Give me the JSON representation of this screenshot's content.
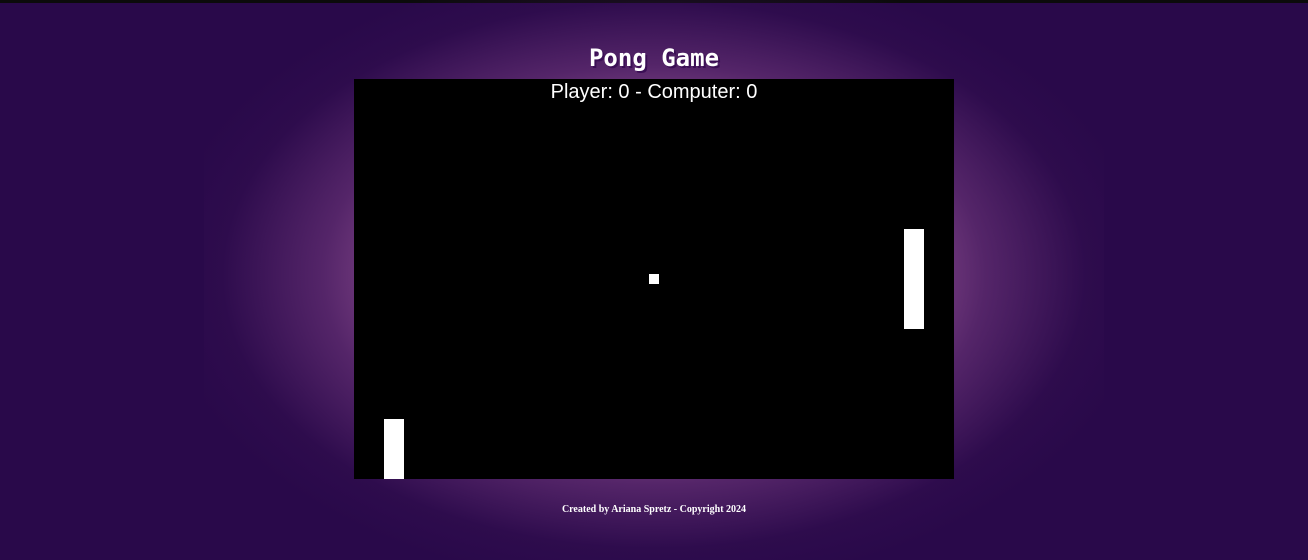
{
  "page": {
    "title": "Pong Game",
    "footer": "Created by Ariana Spretz - Copyright 2024"
  },
  "game": {
    "score_text": "Player: 0 - Computer: 0",
    "player_score": 0,
    "computer_score": 0
  },
  "colors": {
    "background": "#29094a",
    "glow": "#d68cc8",
    "board": "#000000",
    "foreground": "#ffffff"
  }
}
